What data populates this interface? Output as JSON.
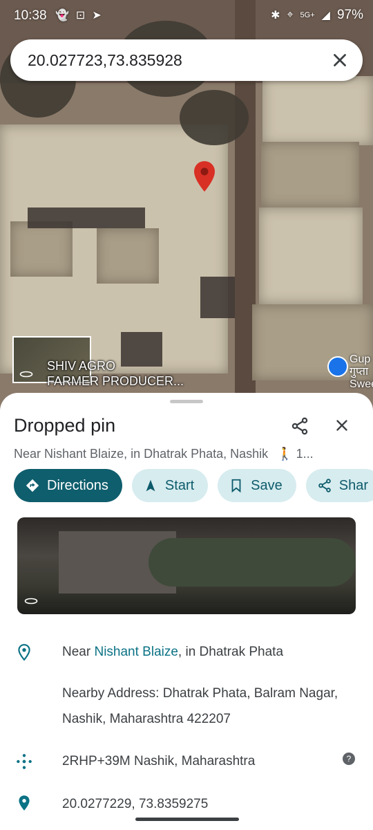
{
  "status_bar": {
    "time": "10:38",
    "network": "5G+",
    "battery": "97%"
  },
  "search": {
    "query": "20.027723,73.835928"
  },
  "map": {
    "poi_left_line1": "SHIV AGRO",
    "poi_left_line2": "FARMER PRODUCER...",
    "poi_right_line1": "Gup",
    "poi_right_line2": "गुप्ता",
    "poi_right_line3": "Swee"
  },
  "place": {
    "title": "Dropped pin",
    "subtitle": "Near Nishant Blaize, in Dhatrak Phata, Nashik",
    "walk_time": "1..."
  },
  "actions": {
    "directions": "Directions",
    "start": "Start",
    "save": "Save",
    "share": "Shar"
  },
  "details": {
    "near_prefix": "Near ",
    "near_link": "Nishant Blaize",
    "near_suffix": ", in Dhatrak Phata",
    "nearby_address": "Nearby Address: Dhatrak Phata, Balram Nagar, Nashik, Maharashtra 422207",
    "plus_code": "2RHP+39M Nashik, Maharashtra",
    "coordinates": "20.0277229, 73.8359275"
  },
  "colors": {
    "accent": "#0f5e6d",
    "chip_bg": "#d7ecef",
    "pin": "#d93025",
    "link": "#0b7285"
  }
}
